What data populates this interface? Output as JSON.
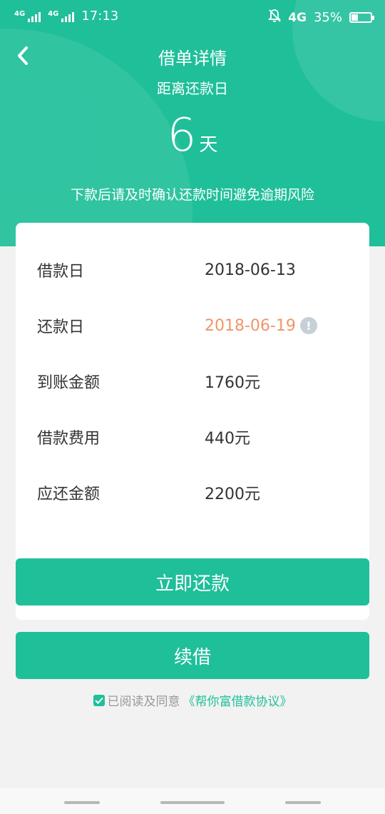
{
  "status_bar": {
    "sim1": "4G",
    "sim2": "4G",
    "time": "17:13",
    "net": "4G",
    "battery": "35%",
    "battery_level": 0.35
  },
  "header": {
    "title": "借单详情",
    "subtitle": "距离还款日",
    "days": "6",
    "days_unit": "天",
    "notice": "下款后请及时确认还款时间避免逾期风险"
  },
  "details": [
    {
      "label": "借款日",
      "value": "2018-06-13"
    },
    {
      "label": "还款日",
      "value": "2018-06-19"
    },
    {
      "label": "到账金额",
      "value": "1760元"
    },
    {
      "label": "借款费用",
      "value": "440元"
    },
    {
      "label": "应还金额",
      "value": "2200元"
    }
  ],
  "buttons": {
    "repay": "立即还款",
    "renew": "续借"
  },
  "agreement": {
    "text": "已阅读及同意",
    "link": "《帮你富借款协议》"
  },
  "colors": {
    "primary": "#1fbf9a",
    "highlight": "#f0956a"
  }
}
